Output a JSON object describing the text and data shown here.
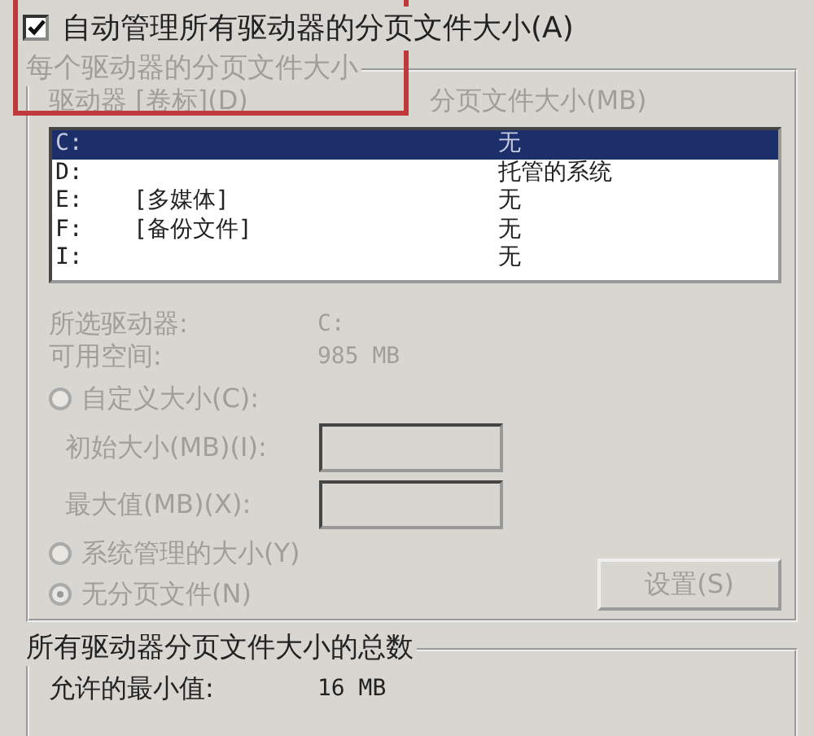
{
  "auto_manage": {
    "label": "自动管理所有驱动器的分页文件大小(A)",
    "checked": true
  },
  "per_drive_group": {
    "legend": "每个驱动器的分页文件大小",
    "disabled": true,
    "columns": [
      "驱动器 [卷标](D)",
      "分页文件大小(MB)"
    ],
    "drives": [
      {
        "drive": "C:",
        "size": "无",
        "selected": true
      },
      {
        "drive": "D:",
        "size": "托管的系统",
        "selected": false
      },
      {
        "drive": "E:",
        "label": "[多媒体]",
        "size": "无",
        "selected": false
      },
      {
        "drive": "F:",
        "label": "[备份文件]",
        "size": "无",
        "selected": false
      },
      {
        "drive": "I:",
        "size": "无",
        "selected": false
      }
    ],
    "info": [
      {
        "label": "所选驱动器:",
        "value": "C:"
      },
      {
        "label": "可用空间:",
        "value": "985 MB"
      }
    ],
    "custom_radio": {
      "label": "自定义大小(C):",
      "selected": false
    },
    "fields": [
      {
        "label": "初始大小(MB)(I):"
      },
      {
        "label": "最大值(MB)(X):"
      }
    ],
    "radios": [
      {
        "label": "系统管理的大小(Y)",
        "selected": false
      },
      {
        "label": "无分页文件(N)",
        "selected": true
      }
    ],
    "set_button": "设置(S)"
  },
  "totals_group": {
    "legend": "所有驱动器分页文件大小的总数",
    "rows": [
      {
        "label": "允许的最小值:",
        "value": "16 MB"
      }
    ]
  }
}
